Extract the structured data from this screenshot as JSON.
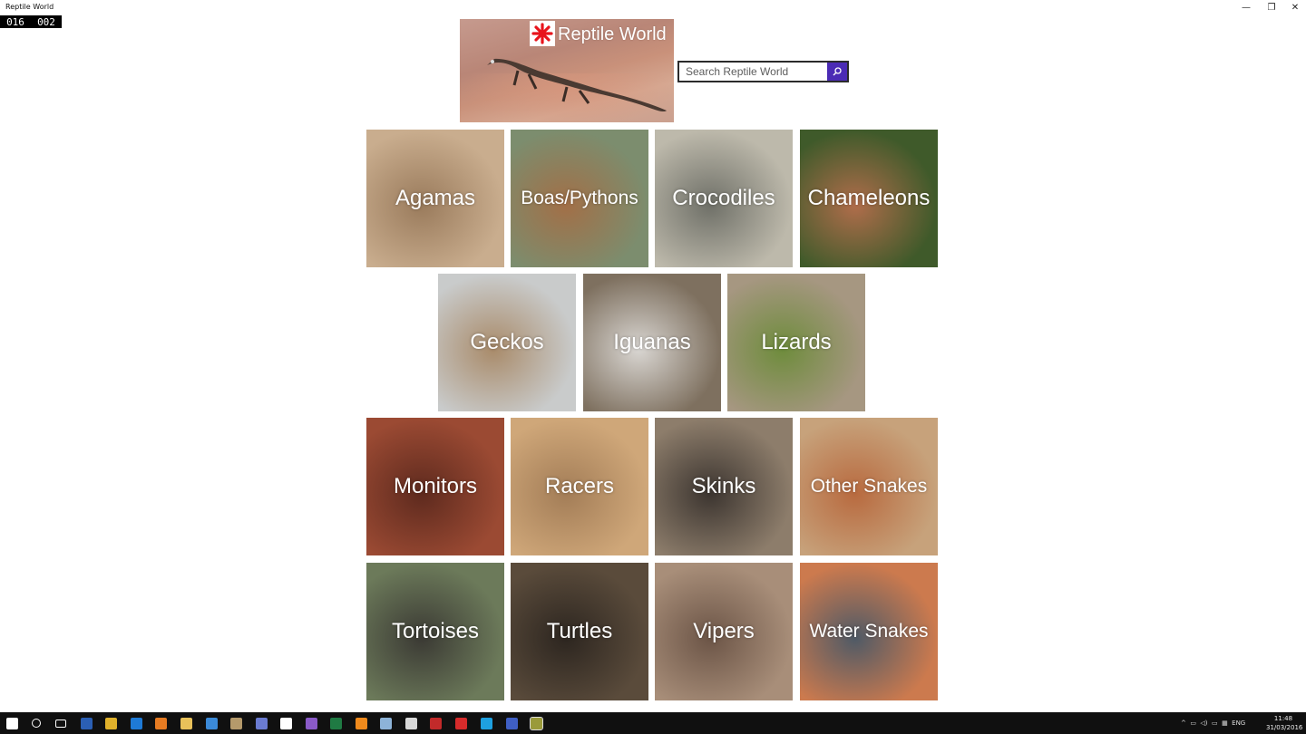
{
  "window": {
    "title": "Reptile World",
    "minimize_glyph": "—",
    "maximize_glyph": "❐",
    "close_glyph": "✕"
  },
  "frame_counter": {
    "left": "016",
    "right": "002"
  },
  "header": {
    "app_name": "Reptile World",
    "logo_icon": "red-asterisk-icon",
    "logo_color": "#e8141c"
  },
  "search": {
    "placeholder": "Search Reptile World",
    "button_icon": "search-icon",
    "button_color": "#4b2bb5"
  },
  "tiles": [
    {
      "label": "Agamas",
      "colors": [
        "#c9ad8e",
        "#9a7b5c"
      ]
    },
    {
      "label": "Boas/Pythons",
      "colors": [
        "#7c8d6e",
        "#a26f47"
      ]
    },
    {
      "label": "Crocodiles",
      "colors": [
        "#bdb9ab",
        "#6f7068"
      ]
    },
    {
      "label": "Chameleons",
      "colors": [
        "#3f5a2a",
        "#b06d4b"
      ]
    },
    {
      "label": "Geckos",
      "colors": [
        "#c9cbcb",
        "#a98b6a"
      ]
    },
    {
      "label": "Iguanas",
      "colors": [
        "#7e705f",
        "#d9d6d2"
      ]
    },
    {
      "label": "Lizards",
      "colors": [
        "#a69781",
        "#6e8c3c"
      ]
    },
    {
      "label": "Monitors",
      "colors": [
        "#9b4a33",
        "#5e2a1e"
      ]
    },
    {
      "label": "Racers",
      "colors": [
        "#cfa779",
        "#a37d57"
      ]
    },
    {
      "label": "Skinks",
      "colors": [
        "#8d7d6b",
        "#3c3530"
      ]
    },
    {
      "label": "Other Snakes",
      "colors": [
        "#c7a27b",
        "#b86a3f"
      ]
    },
    {
      "label": "Tortoises",
      "colors": [
        "#6c7a5a",
        "#3b3a34"
      ]
    },
    {
      "label": "Turtles",
      "colors": [
        "#5a4b3b",
        "#2d2620"
      ]
    },
    {
      "label": "Vipers",
      "colors": [
        "#a88e79",
        "#6c5547"
      ]
    },
    {
      "label": "Water Snakes",
      "colors": [
        "#cc7a4e",
        "#4f5a66"
      ]
    }
  ],
  "taskbar": {
    "icons": [
      {
        "name": "start-icon",
        "color": "#ffffff"
      },
      {
        "name": "cortana-icon",
        "color": "#ffffff"
      },
      {
        "name": "task-view-icon",
        "color": "#ffffff"
      },
      {
        "name": "word-icon",
        "color": "#2b5fb4"
      },
      {
        "name": "chrome-icon",
        "color": "#e0b12b"
      },
      {
        "name": "edge-icon",
        "color": "#1e7ad6"
      },
      {
        "name": "firefox-icon",
        "color": "#e67b22"
      },
      {
        "name": "file-explorer-icon",
        "color": "#e8c15a"
      },
      {
        "name": "mail-icon",
        "color": "#3b8ad8"
      },
      {
        "name": "app-icon-1",
        "color": "#b59a6b"
      },
      {
        "name": "app-icon-2",
        "color": "#6a7bd1"
      },
      {
        "name": "settings-icon",
        "color": "#ffffff"
      },
      {
        "name": "visual-studio-icon",
        "color": "#8a5ac8"
      },
      {
        "name": "excel-icon",
        "color": "#1f7a43"
      },
      {
        "name": "vlc-icon",
        "color": "#f08a1c"
      },
      {
        "name": "app-icon-3",
        "color": "#8db3d8"
      },
      {
        "name": "app-icon-4",
        "color": "#d8d8d8"
      },
      {
        "name": "app-icon-5",
        "color": "#c22a2a"
      },
      {
        "name": "acrobat-icon",
        "color": "#d62b2b"
      },
      {
        "name": "skype-icon",
        "color": "#1ea0e0"
      },
      {
        "name": "app-icon-6",
        "color": "#3f5fc4"
      },
      {
        "name": "reptile-world-taskbar-icon",
        "color": "#9a9a3a"
      }
    ],
    "language": "ENG",
    "time": "11:48",
    "date": "31/03/2016"
  }
}
